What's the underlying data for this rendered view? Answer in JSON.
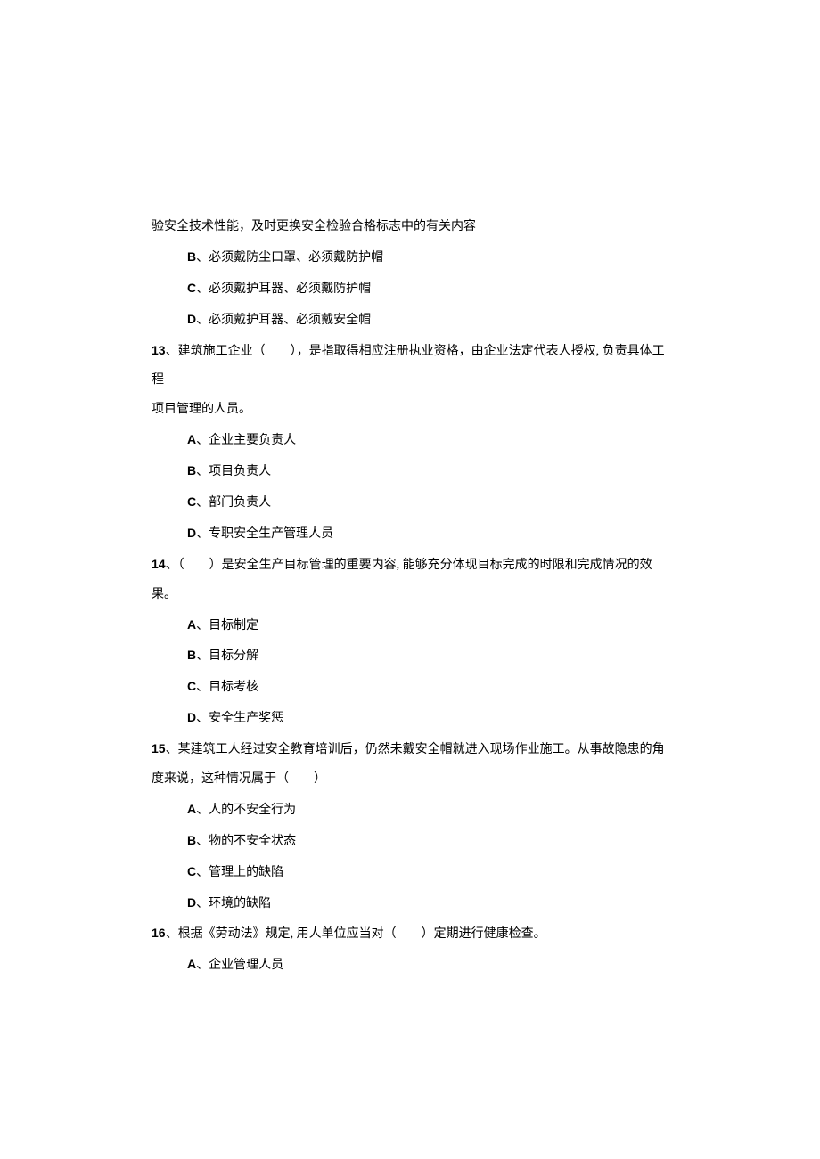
{
  "intro": "验安全技术性能，及时更换安全检验合格标志中的有关内容",
  "opts_pre": [
    {
      "label": "B",
      "text": "、必须戴防尘口罩、必须戴防护帽"
    },
    {
      "label": "C",
      "text": "、必须戴护耳器、必须戴防护帽"
    },
    {
      "label": "D",
      "text": "、必须戴护耳器、必须戴安全帽"
    }
  ],
  "q13_num": "13",
  "q13_text_a": "、建筑施工企业（　　），是指取得相应注册执业资格，由企业法定代表人授权, 负责具体工",
  "q13_text_b": "程",
  "q13_text_c": "项目管理的人员。",
  "q13_opts": [
    {
      "label": "A",
      "text": "、企业主要负责人"
    },
    {
      "label": "B",
      "text": "、项目负责人"
    },
    {
      "label": "C",
      "text": "、部门负责人"
    },
    {
      "label": "D",
      "text": "、专职安全生产管理人员"
    }
  ],
  "q14_num": "14",
  "q14_text_a": "、（　　）是安全生产目标管理的重要内容, 能够充分体现目标完成的时限和完成情况的效",
  "q14_text_b": "果。",
  "q14_opts": [
    {
      "label": "A",
      "text": "、目标制定"
    },
    {
      "label": "B",
      "text": "、目标分解"
    },
    {
      "label": "C",
      "text": "、目标考核"
    },
    {
      "label": "D",
      "text": "、安全生产奖惩"
    }
  ],
  "q15_num": "15",
  "q15_text_a": "、某建筑工人经过安全教育培训后，仍然未戴安全帽就进入现场作业施工。从事故隐患的角",
  "q15_text_b": "度来说，这种情况属于（　　）",
  "q15_opts": [
    {
      "label": "A",
      "text": "、人的不安全行为"
    },
    {
      "label": "B",
      "text": "、物的不安全状态"
    },
    {
      "label": "C",
      "text": "、管理上的缺陷"
    },
    {
      "label": "D",
      "text": "、环境的缺陷"
    }
  ],
  "q16_num": "16",
  "q16_text": "、根据《劳动法》规定, 用人单位应当对（　　）定期进行健康检查。",
  "q16_opts": [
    {
      "label": "A",
      "text": "、企业管理人员"
    }
  ]
}
